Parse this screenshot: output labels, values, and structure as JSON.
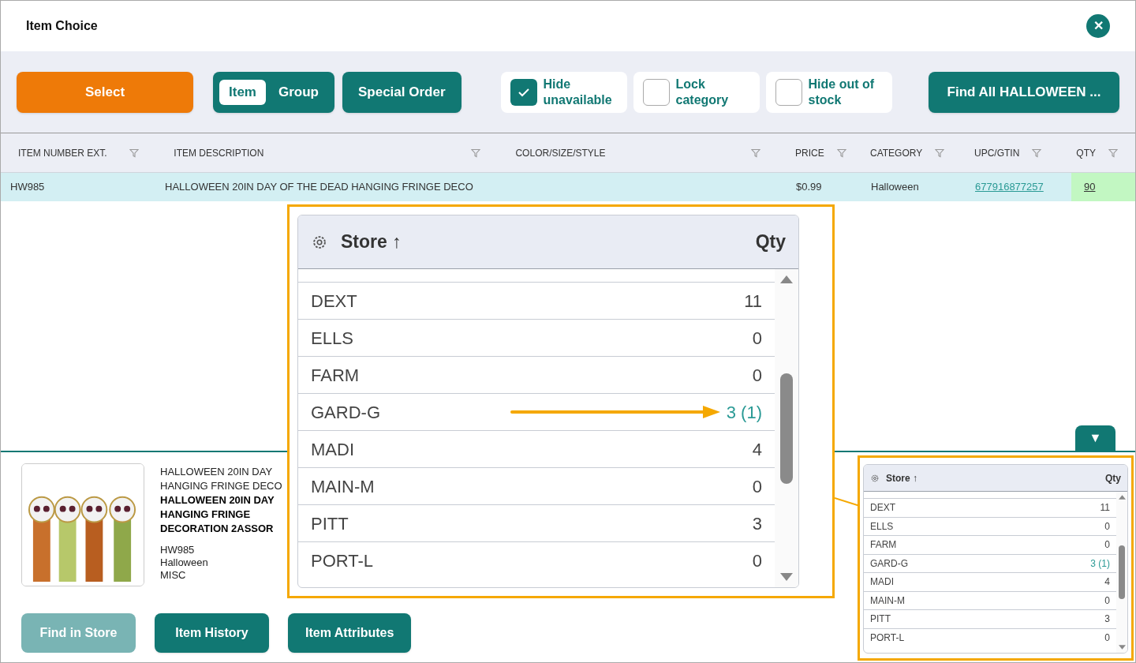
{
  "window": {
    "title": "Item Choice",
    "close_label": "✕"
  },
  "toolbar": {
    "select_button": "Select",
    "mode_toggle": [
      {
        "label": "Item",
        "selected": true
      },
      {
        "label": "Group",
        "selected": false
      }
    ],
    "special_order_button": "Special Order",
    "checkboxes": [
      {
        "label": "Hide unavailable",
        "checked": true
      },
      {
        "label": "Lock category",
        "checked": false
      },
      {
        "label": "Hide out of stock",
        "checked": false
      }
    ],
    "find_all_button": "Find All HALLOWEEN ..."
  },
  "table": {
    "columns": [
      "ITEM NUMBER EXT.",
      "ITEM DESCRIPTION",
      "COLOR/SIZE/STYLE",
      "PRICE",
      "CATEGORY",
      "UPC/GTIN",
      "QTY"
    ],
    "rows": [
      {
        "selected": true,
        "item_number": "HW985",
        "description": "HALLOWEEN 20IN DAY OF THE DEAD HANGING FRINGE DECO",
        "price": "$0.99",
        "category": "Halloween",
        "upc": "677916877257",
        "qty": "90"
      }
    ]
  },
  "expand_toggle": "▼",
  "details": {
    "plain_lines": [
      "HALLOWEEN 20IN DAY",
      "HANGING FRINGE DECO"
    ],
    "bold_lines": [
      "HALLOWEEN 20IN DAY",
      "HANGING FRINGE",
      "DECORATION 2ASSOR"
    ],
    "meta_lines": [
      "HW985",
      "Halloween",
      "MISC"
    ]
  },
  "buttons": [
    {
      "label": "Find in Store",
      "disabled": true
    },
    {
      "label": "Item History",
      "disabled": false
    },
    {
      "label": "Item Attributes",
      "disabled": false
    }
  ],
  "store_panel": {
    "store_header": "Store ↑",
    "qty_header": "Qty",
    "rows": [
      {
        "store": "DEXT",
        "qty": "11",
        "highlighted": false
      },
      {
        "store": "ELLS",
        "qty": "0",
        "highlighted": false
      },
      {
        "store": "FARM",
        "qty": "0",
        "highlighted": false
      },
      {
        "store": "GARD-G",
        "qty": "3 (1)",
        "highlighted": true
      },
      {
        "store": "MADI",
        "qty": "4",
        "highlighted": false
      },
      {
        "store": "MAIN-M",
        "qty": "0",
        "highlighted": false
      },
      {
        "store": "PITT",
        "qty": "3",
        "highlighted": false
      },
      {
        "store": "PORT-L",
        "qty": "0",
        "highlighted": false
      }
    ]
  },
  "zoom_callout": {
    "store_header": "Store ↑",
    "qty_header": "Qty",
    "rows": [
      {
        "store": "DEXT",
        "qty": "11",
        "highlighted": false
      },
      {
        "store": "ELLS",
        "qty": "0",
        "highlighted": false
      },
      {
        "store": "FARM",
        "qty": "0",
        "highlighted": false
      },
      {
        "store": "GARD-G",
        "qty": "3 (1)",
        "highlighted": true
      },
      {
        "store": "MADI",
        "qty": "4",
        "highlighted": false
      },
      {
        "store": "MAIN-M",
        "qty": "0",
        "highlighted": false
      },
      {
        "store": "PITT",
        "qty": "3",
        "highlighted": false
      },
      {
        "store": "PORT-L",
        "qty": "0",
        "highlighted": false
      }
    ]
  }
}
